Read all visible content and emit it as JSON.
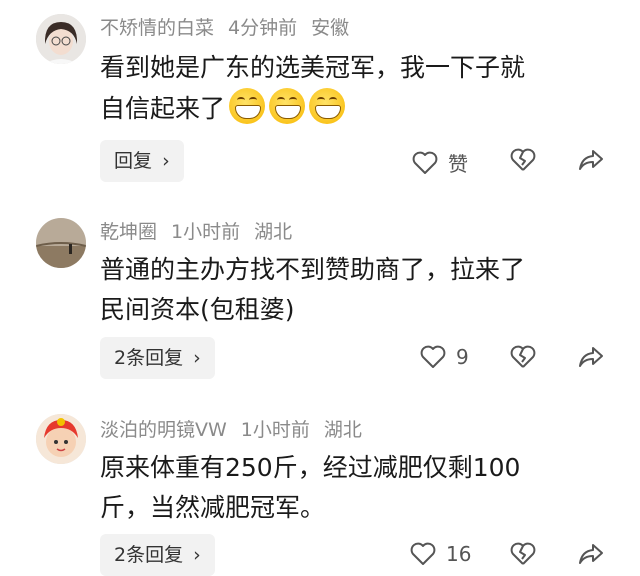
{
  "comments": [
    {
      "user": "不矫情的白菜",
      "time": "4分钟前",
      "location": "安徽",
      "text_line1": "看到她是广东的选美冠军，我一下子就",
      "text_line2": "自信起来了",
      "emoji_count": 3,
      "reply_label": "回复",
      "like_label": "赞"
    },
    {
      "user": "乾坤圈",
      "time": "1小时前",
      "location": "湖北",
      "text_line1": "普通的主办方找不到赞助商了，拉来了",
      "text_line2": "民间资本(包租婆)",
      "reply_label": "2条回复",
      "like_count": "9"
    },
    {
      "user": "淡泊的明镜VW",
      "time": "1小时前",
      "location": "湖北",
      "text_line1": "原来体重有250斤，经过减肥仅剩100",
      "text_line2": "斤，当然减肥冠军。",
      "reply_label": "2条回复",
      "like_count": "16"
    }
  ],
  "icons": {
    "like": "heart-outline",
    "dislike": "broken-heart",
    "share": "share-arrow",
    "chevron": "chevron-right"
  },
  "colors": {
    "meta_text": "#8a8a8a",
    "body_text": "#1a1a1a",
    "button_bg": "#f2f2f2"
  }
}
